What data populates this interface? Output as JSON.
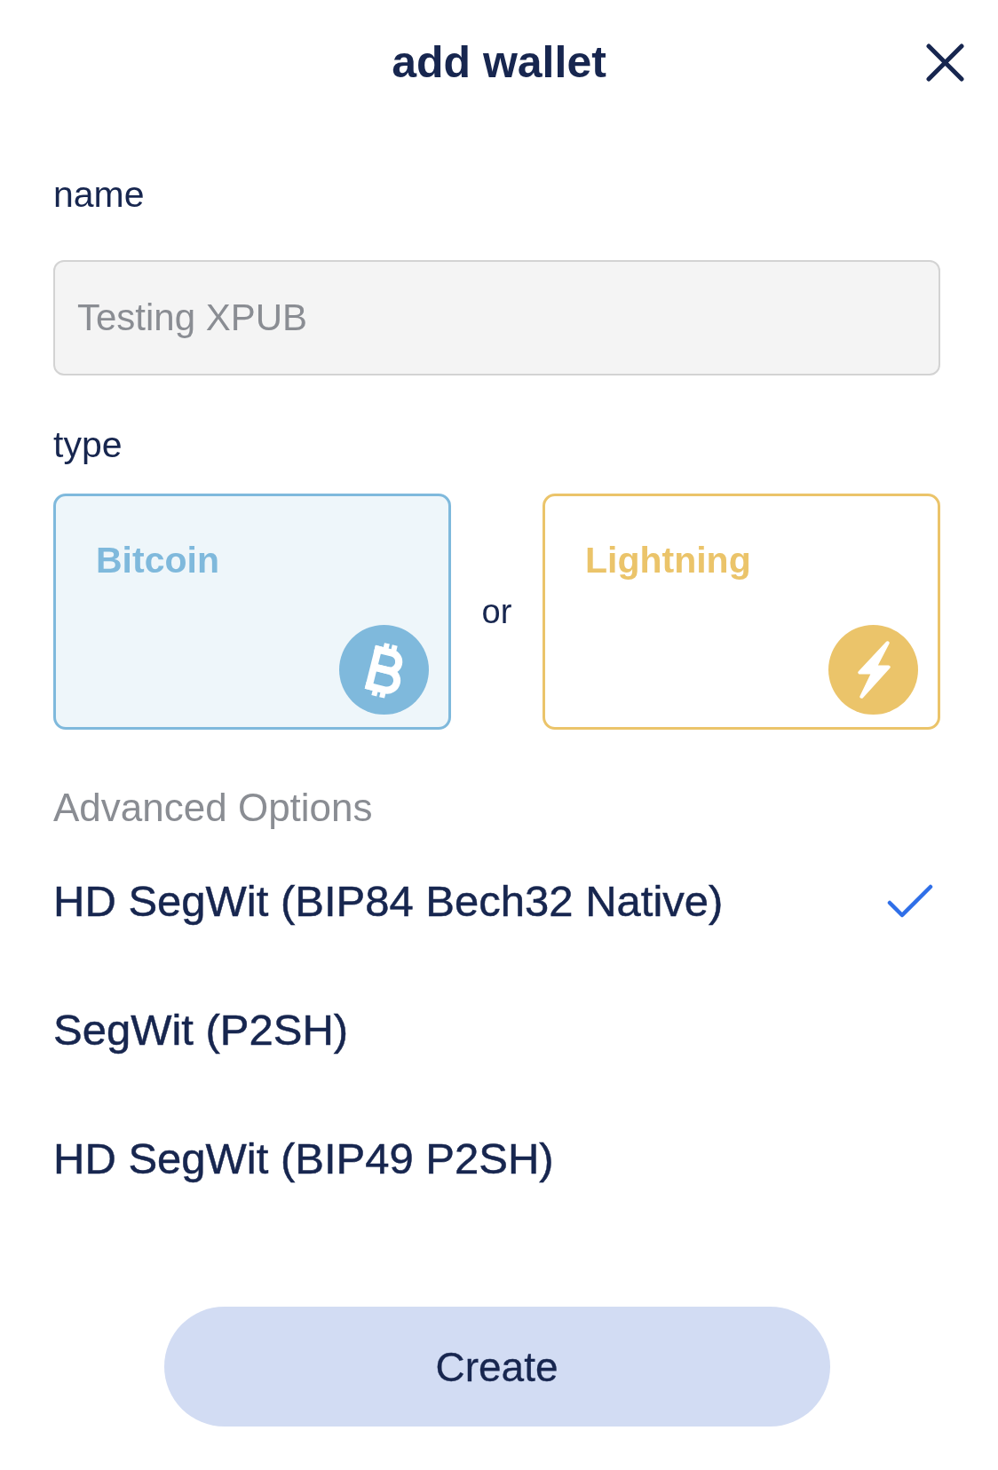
{
  "header": {
    "title": "add wallet"
  },
  "name_field": {
    "label": "name",
    "value": "Testing XPUB"
  },
  "type_picker": {
    "label": "type",
    "separator": "or",
    "options": [
      {
        "kind": "bitcoin",
        "label": "Bitcoin",
        "selected": true,
        "color": "#7fb9dc"
      },
      {
        "kind": "lightning",
        "label": "Lightning",
        "selected": false,
        "color": "#ebc46a"
      }
    ]
  },
  "advanced_options": {
    "heading": "Advanced Options",
    "options": [
      {
        "label": "HD SegWit (BIP84 Bech32 Native)",
        "selected": true
      },
      {
        "label": "SegWit (P2SH)",
        "selected": false
      },
      {
        "label": "HD SegWit (BIP49 P2SH)",
        "selected": false
      }
    ]
  },
  "create_button": {
    "label": "Create"
  }
}
